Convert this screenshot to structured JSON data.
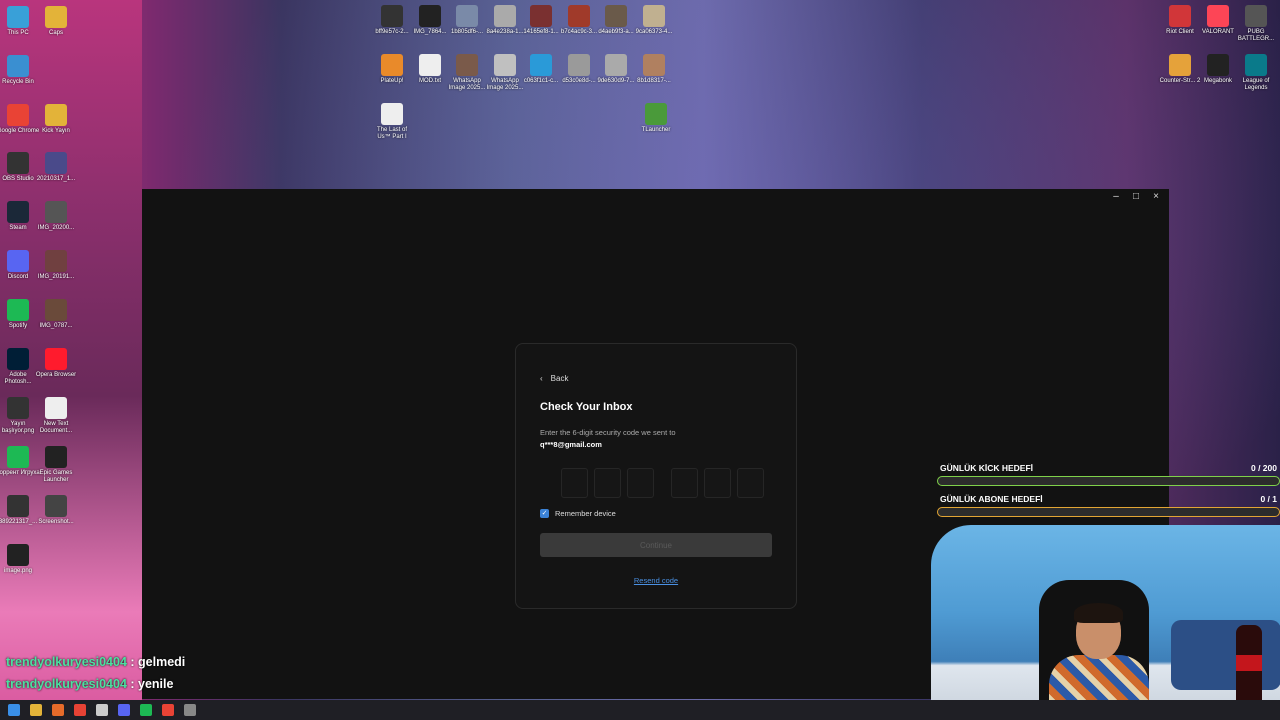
{
  "desktop": {
    "left_icons": [
      {
        "label": "This PC",
        "icon": "computer-icon",
        "color": "#39a0d8"
      },
      {
        "label": "Caps",
        "icon": "folder-icon",
        "color": "#e3b339"
      },
      {
        "label": "Recycle Bin",
        "icon": "recycle-bin-icon",
        "color": "#3a8fd1"
      },
      {
        "label": "Google Chrome",
        "icon": "chrome-icon",
        "color": "#e94335"
      },
      {
        "label": "Kick Yayın",
        "icon": "folder-icon",
        "color": "#e3b339"
      },
      {
        "label": "OBS Studio",
        "icon": "obs-icon",
        "color": "#333333"
      },
      {
        "label": "20210317_1...",
        "icon": "image-icon",
        "color": "#4a4a8a"
      },
      {
        "label": "Steam",
        "icon": "steam-icon",
        "color": "#1b2838"
      },
      {
        "label": "IMG_20200...",
        "icon": "image-icon",
        "color": "#555555"
      },
      {
        "label": "Discord",
        "icon": "discord-icon",
        "color": "#5865f2"
      },
      {
        "label": "IMG_20191...",
        "icon": "image-icon",
        "color": "#704040"
      },
      {
        "label": "Spotify",
        "icon": "spotify-icon",
        "color": "#1db954"
      },
      {
        "label": "IMG_0787...",
        "icon": "image-icon",
        "color": "#6a4a3a"
      },
      {
        "label": "Adobe Photosh...",
        "icon": "photoshop-icon",
        "color": "#001e36"
      },
      {
        "label": "Opera Browser",
        "icon": "opera-icon",
        "color": "#ff1b2d"
      },
      {
        "label": "Yayın başlıyor.png",
        "icon": "image-icon",
        "color": "#333333"
      },
      {
        "label": "New Text Document...",
        "icon": "text-file-icon",
        "color": "#eeeeee"
      },
      {
        "label": "Торрент Игруха",
        "icon": "torrent-icon",
        "color": "#1db954"
      },
      {
        "label": "Epic Games Launcher",
        "icon": "epic-games-icon",
        "color": "#222222"
      },
      {
        "label": "389221317_...",
        "icon": "image-icon",
        "color": "#333333"
      },
      {
        "label": "Screenshot...",
        "icon": "image-icon",
        "color": "#444444"
      },
      {
        "label": "image.png",
        "icon": "image-icon",
        "color": "#222222"
      }
    ],
    "top_icons": [
      {
        "label": "bff9e57c-2...",
        "icon": "image-icon",
        "color": "#333333"
      },
      {
        "label": "IMG_7864...",
        "icon": "image-icon",
        "color": "#222222"
      },
      {
        "label": "1b805df6-...",
        "icon": "image-icon",
        "color": "#7a8aa8"
      },
      {
        "label": "8a4e238a-1...",
        "icon": "image-icon",
        "color": "#aaaaaa"
      },
      {
        "label": "14165ef8-1...",
        "icon": "image-icon",
        "color": "#7a3030"
      },
      {
        "label": "b7c4ac9c-3...",
        "icon": "image-icon",
        "color": "#a03a2a"
      },
      {
        "label": "d4aeb9f3-a...",
        "icon": "image-icon",
        "color": "#6a5a4a"
      },
      {
        "label": "9ca06373-4...",
        "icon": "image-icon",
        "color": "#c0b090"
      },
      {
        "label": "PlateUp!",
        "icon": "plateup-icon",
        "color": "#e98a2a"
      },
      {
        "label": "MOD.txt",
        "icon": "text-file-icon",
        "color": "#eeeeee"
      },
      {
        "label": "WhatsApp Image 2025...",
        "icon": "image-icon",
        "color": "#7a5a4a"
      },
      {
        "label": "WhatsApp Image 2025...",
        "icon": "image-icon",
        "color": "#c0c0c0"
      },
      {
        "label": "c063f1c1-c...",
        "icon": "image-icon",
        "color": "#2a9ad8"
      },
      {
        "label": "d53c0e8d-...",
        "icon": "image-icon",
        "color": "#9a9a9a"
      },
      {
        "label": "9de630d9-7...",
        "icon": "image-icon",
        "color": "#aaaaaa"
      },
      {
        "label": "8b1d8317-...",
        "icon": "image-icon",
        "color": "#b08060"
      },
      {
        "label": "The Last of Us™ Part I",
        "icon": "text-file-icon",
        "color": "#eeeeee"
      },
      {
        "label": "TLauncher",
        "icon": "minecraft-icon",
        "color": "#4a9a3a"
      }
    ],
    "right_icons": [
      {
        "label": "Riot Client",
        "icon": "riot-icon",
        "color": "#d13639"
      },
      {
        "label": "VALORANT",
        "icon": "valorant-icon",
        "color": "#fd4556"
      },
      {
        "label": "PUBG BATTLEGR...",
        "icon": "pubg-icon",
        "color": "#555555"
      },
      {
        "label": "Counter-Str... 2",
        "icon": "cs2-icon",
        "color": "#e5a23a"
      },
      {
        "label": "Megabonk",
        "icon": "megabonk-icon",
        "color": "#222222"
      },
      {
        "label": "League of Legends",
        "icon": "league-icon",
        "color": "#0a7a8a"
      }
    ]
  },
  "window": {
    "controls": {
      "minimize": "–",
      "maximize": "□",
      "close": "×"
    }
  },
  "dialog": {
    "back_label": "Back",
    "title": "Check Your Inbox",
    "description": "Enter the 6-digit security code we sent to",
    "email": "q***8@gmail.com",
    "code_digits": [
      "",
      "",
      "",
      "",
      "",
      ""
    ],
    "remember_label": "Remember device",
    "remember_checked": true,
    "continue_label": "Continue",
    "resend_label": "Resend code"
  },
  "overlay": {
    "goals": [
      {
        "label": "GÜNLÜK KİCK HEDEFİ",
        "count": "0 / 200",
        "progress": 0,
        "color": "#7fd14a"
      },
      {
        "label": "GÜNLÜK ABONE HEDEFİ",
        "count": "0 / 1",
        "progress": 0,
        "color": "#e2a534"
      }
    ],
    "chat": [
      {
        "user": "trendyolkuryesi0404",
        "sep": " : ",
        "message": "gelmedi"
      },
      {
        "user": "trendyolkuryesi0404",
        "sep": " : ",
        "message": "yenile"
      }
    ]
  },
  "taskbar": {
    "icons": [
      {
        "name": "start-icon",
        "color": "#3a8fe8"
      },
      {
        "name": "file-explorer-icon",
        "color": "#e3b339"
      },
      {
        "name": "firefox-icon",
        "color": "#e66b2a"
      },
      {
        "name": "chrome-icon",
        "color": "#e94335"
      },
      {
        "name": "steam-icon",
        "color": "#cccccc"
      },
      {
        "name": "discord-icon",
        "color": "#5865f2"
      },
      {
        "name": "spotify-icon",
        "color": "#1db954"
      },
      {
        "name": "chrome-icon",
        "color": "#e94335"
      },
      {
        "name": "app-icon",
        "color": "#888888"
      }
    ]
  }
}
